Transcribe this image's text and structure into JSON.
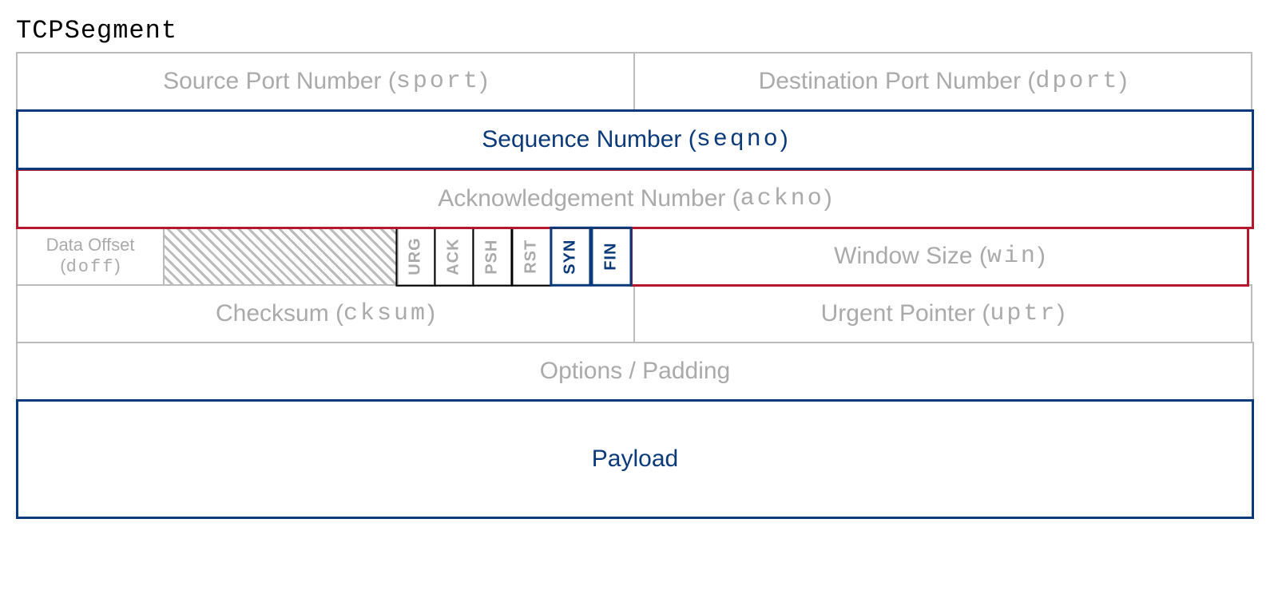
{
  "title": "TCPSegment",
  "fields": {
    "sport": {
      "label": "Source Port Number",
      "code": "sport"
    },
    "dport": {
      "label": "Destination Port Number",
      "code": "dport"
    },
    "seqno": {
      "label": "Sequence Number",
      "code": "seqno"
    },
    "ackno": {
      "label": "Acknowledgement Number",
      "code": "ackno"
    },
    "doff": {
      "label": "Data Offset",
      "code": "doff"
    },
    "win": {
      "label": "Window Size",
      "code": "win"
    },
    "cksum": {
      "label": "Checksum",
      "code": "cksum"
    },
    "uptr": {
      "label": "Urgent Pointer",
      "code": "uptr"
    },
    "options": {
      "label": "Options / Padding"
    },
    "payload": {
      "label": "Payload"
    }
  },
  "flags": [
    "URG",
    "ACK",
    "PSH",
    "RST",
    "SYN",
    "FIN"
  ]
}
